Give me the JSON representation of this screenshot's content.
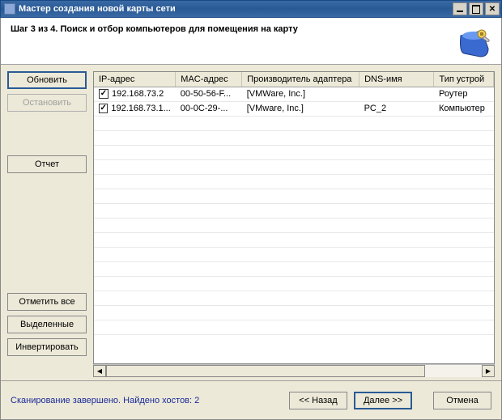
{
  "window": {
    "title": "Мастер создания новой карты сети"
  },
  "header": {
    "step": "Шаг 3 из 4. Поиск и отбор компьютеров для помещения на карту"
  },
  "sidebar": {
    "refresh": "Обновить",
    "stop": "Остановить",
    "report": "Отчет",
    "select_all": "Отметить все",
    "selected": "Выделенные",
    "invert": "Инвертировать"
  },
  "table": {
    "columns": {
      "ip": "IP-адрес",
      "mac": "MAC-адрес",
      "manufacturer": "Производитель адаптера",
      "dns": "DNS-имя",
      "device_type": "Тип устрой"
    },
    "rows": [
      {
        "checked": true,
        "ip": "192.168.73.2",
        "mac": "00-50-56-F...",
        "manufacturer": "[VMWare, Inc.]",
        "dns": "",
        "device_type": "Роутер"
      },
      {
        "checked": true,
        "ip": "192.168.73.1...",
        "mac": "00-0C-29-...",
        "manufacturer": "[VMware, Inc.]",
        "dns": "PC_2",
        "device_type": "Компьютер"
      }
    ]
  },
  "footer": {
    "status": "Сканирование завершено. Найдено хостов: 2",
    "back": "<< Назад",
    "next": "Далее >>",
    "cancel": "Отмена"
  }
}
